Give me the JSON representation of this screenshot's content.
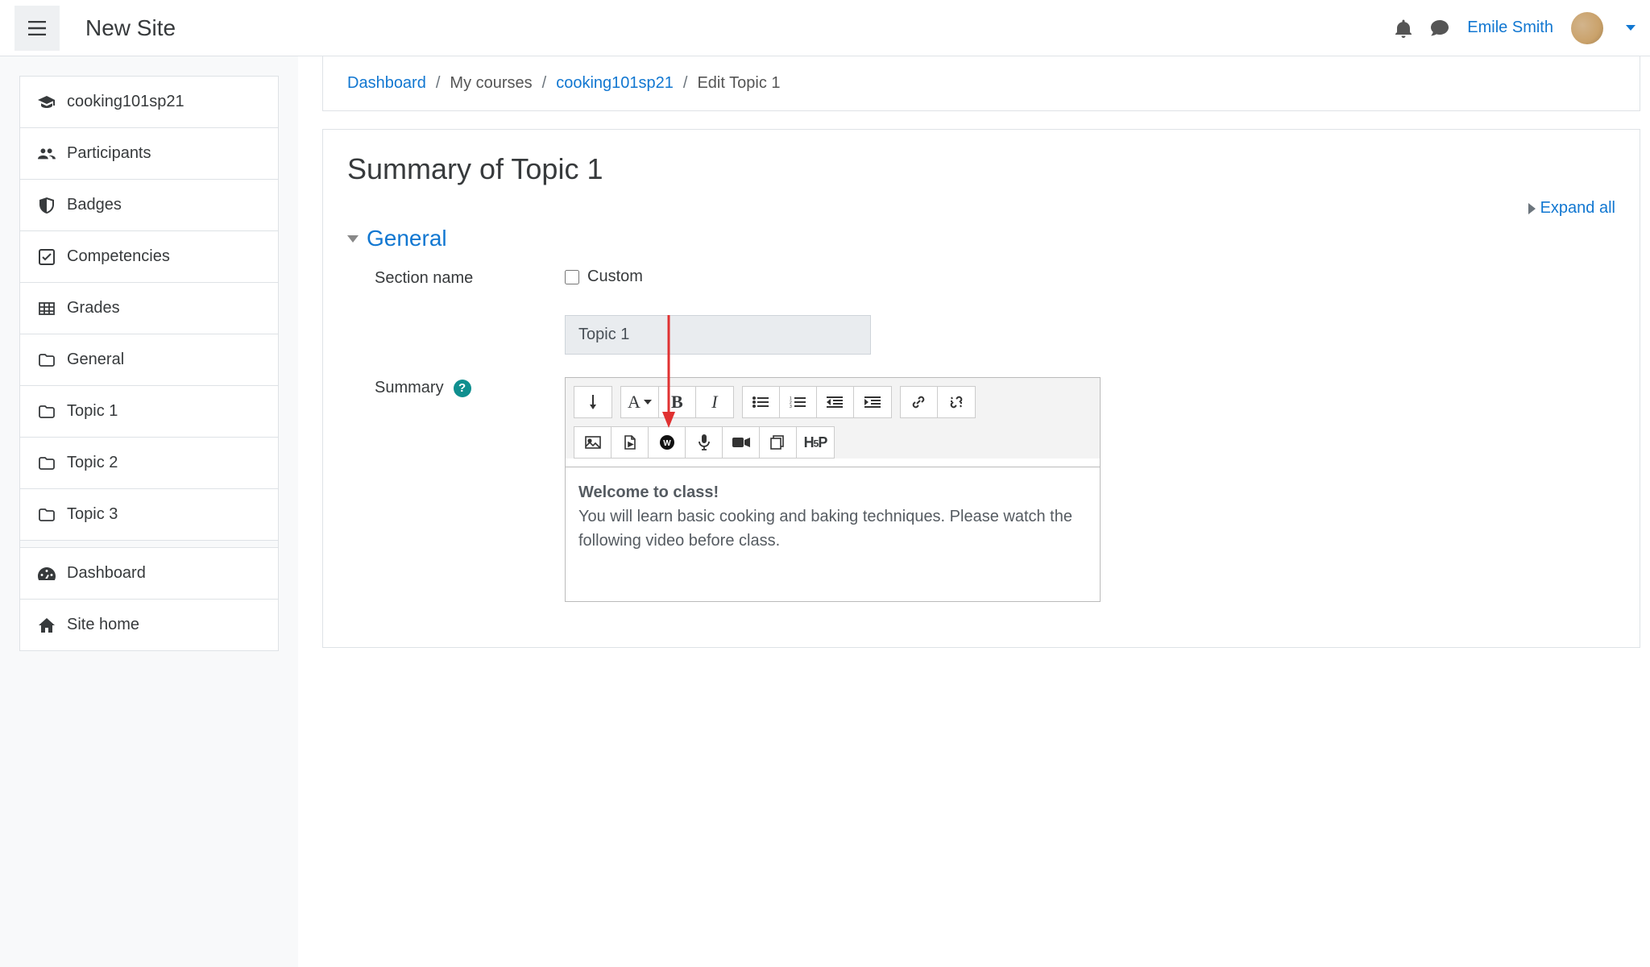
{
  "navbar": {
    "site_title": "New Site",
    "user_name": "Emile Smith"
  },
  "sidebar": {
    "items": [
      {
        "icon": "graduation-cap-icon",
        "label": "cooking101sp21"
      },
      {
        "icon": "users-icon",
        "label": "Participants"
      },
      {
        "icon": "shield-icon",
        "label": "Badges"
      },
      {
        "icon": "check-icon",
        "label": "Competencies"
      },
      {
        "icon": "grid-icon",
        "label": "Grades"
      },
      {
        "icon": "folder-icon",
        "label": "General"
      },
      {
        "icon": "folder-icon",
        "label": "Topic 1"
      },
      {
        "icon": "folder-icon",
        "label": "Topic 2"
      },
      {
        "icon": "folder-icon",
        "label": "Topic 3"
      }
    ],
    "bottom_items": [
      {
        "icon": "gauge-icon",
        "label": "Dashboard"
      },
      {
        "icon": "home-icon",
        "label": "Site home"
      }
    ]
  },
  "breadcrumb": {
    "dashboard": "Dashboard",
    "my_courses": "My courses",
    "course_short": "cooking101sp21",
    "current": "Edit Topic 1"
  },
  "form": {
    "heading": "Summary of Topic 1",
    "expand_all": "Expand all",
    "section_general": "General",
    "section_name_label": "Section name",
    "custom_label": "Custom",
    "section_name_value": "Topic 1",
    "summary_label": "Summary",
    "editor_content_bold": "Welcome to class!",
    "editor_content_body": "You will learn basic cooking and baking techniques. Please watch the following video before class.",
    "toolbar": {
      "h5p_label": "H-P"
    }
  }
}
